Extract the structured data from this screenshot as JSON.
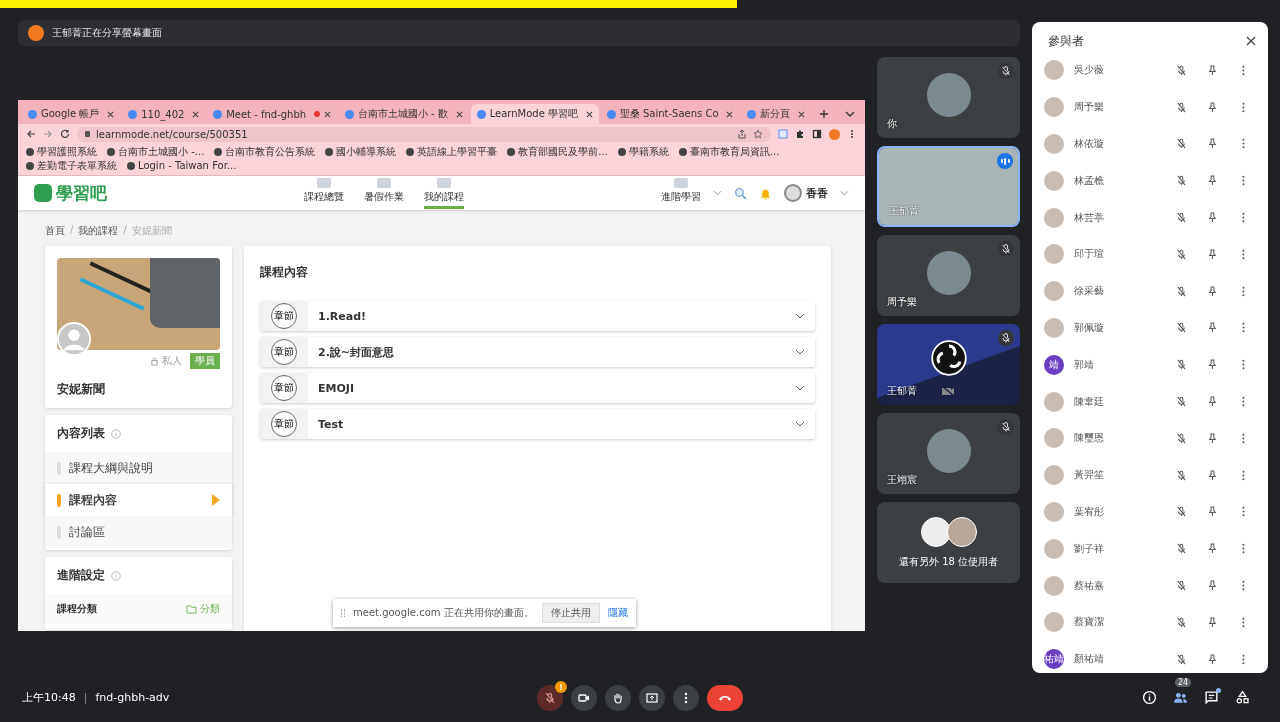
{
  "presentation_banner": {
    "text": "王郁菁正在分享螢幕畫面"
  },
  "shared_screen": {
    "browser": {
      "tabs": [
        {
          "title": "Google 帳戶",
          "selected": false,
          "recording": false
        },
        {
          "title": "110_402",
          "selected": false,
          "recording": false
        },
        {
          "title": "Meet - fnd-ghbh",
          "selected": false,
          "recording": true
        },
        {
          "title": "台南市土城國小 - 歡",
          "selected": false,
          "recording": false
        },
        {
          "title": "LearnMode 學習吧",
          "selected": true,
          "recording": false
        },
        {
          "title": "聖桑 Saint-Saens Co",
          "selected": false,
          "recording": false
        },
        {
          "title": "新分頁",
          "selected": false,
          "recording": false
        }
      ],
      "url": "learnmode.net/course/500351",
      "bookmarks": [
        {
          "label": "學習護照系統"
        },
        {
          "label": "台南市土城國小 -..."
        },
        {
          "label": "台南市教育公告系統"
        },
        {
          "label": "國小輔導系統"
        },
        {
          "label": "英語線上學習平臺"
        },
        {
          "label": "教育部國民及學前..."
        },
        {
          "label": "學籍系統"
        },
        {
          "label": "臺南市教育局資訊..."
        },
        {
          "label": "差勤電子表單系統"
        },
        {
          "label": "Login - Taiwan For..."
        }
      ]
    },
    "site": {
      "logo": "學習吧",
      "nav": [
        {
          "label": "課程總覽",
          "selected": false
        },
        {
          "label": "暑假作業",
          "selected": false
        },
        {
          "label": "我的課程",
          "selected": true
        }
      ],
      "advanced": "進階學習",
      "user": "香香",
      "breadcrumb": {
        "separator": "/",
        "items": [
          "首頁",
          "我的課程",
          "安妮新聞"
        ]
      },
      "course": {
        "privacy": "私人",
        "role": "學員",
        "title": "安妮新聞"
      },
      "content_list": {
        "title": "內容列表",
        "items": [
          {
            "label": "課程大綱與說明",
            "selected": false
          },
          {
            "label": "課程內容",
            "selected": true
          },
          {
            "label": "討論區",
            "selected": false
          }
        ]
      },
      "settings": {
        "title": "進階設定",
        "rows": [
          {
            "label": "課程分類",
            "action": "分類"
          }
        ]
      },
      "content": {
        "title": "課程內容",
        "chapters": [
          {
            "tag": "章節",
            "title": "1.Read!"
          },
          {
            "tag": "章節",
            "title": "2.說~封面意思"
          },
          {
            "tag": "章節",
            "title": "EMOJI"
          },
          {
            "tag": "章節",
            "title": "Test"
          }
        ]
      }
    },
    "share_notice": {
      "text": "meet.google.com 正在共用你的畫面。",
      "stop": "停止共用",
      "hide": "隱藏"
    }
  },
  "tiles": [
    {
      "name": "你",
      "kind": "avatar",
      "muted": true,
      "speaking": false
    },
    {
      "name": "王郁菁",
      "kind": "video",
      "muted": false,
      "speaking": true
    },
    {
      "name": "周予樂",
      "kind": "avatar",
      "muted": true,
      "speaking": false
    },
    {
      "name": "王郁菁",
      "kind": "logo",
      "muted": true,
      "speaking": false
    },
    {
      "name": "王翊宸",
      "kind": "avatar",
      "muted": true,
      "speaking": false
    }
  ],
  "more_tile": {
    "text": "還有另外 18 位使用者"
  },
  "participants_panel": {
    "title": "參與者",
    "participants": [
      {
        "name": "吳少薇",
        "kind": "photo",
        "muted": true
      },
      {
        "name": "周予樂",
        "kind": "photo",
        "muted": true
      },
      {
        "name": "林依璇",
        "kind": "photo",
        "muted": true
      },
      {
        "name": "林孟樵",
        "kind": "photo",
        "muted": true
      },
      {
        "name": "林芸葶",
        "kind": "photo",
        "muted": true
      },
      {
        "name": "邱于瑄",
        "kind": "photo",
        "muted": true
      },
      {
        "name": "徐采藝",
        "kind": "photo",
        "muted": true
      },
      {
        "name": "郭佩璇",
        "kind": "photo",
        "muted": true
      },
      {
        "name": "郭靖",
        "kind": "initials",
        "initials": "靖",
        "muted": true
      },
      {
        "name": "陳韋廷",
        "kind": "photo",
        "muted": true
      },
      {
        "name": "陳璽恩",
        "kind": "photo",
        "muted": true
      },
      {
        "name": "黃羿笙",
        "kind": "photo",
        "muted": true
      },
      {
        "name": "葉宥彤",
        "kind": "photo",
        "muted": true
      },
      {
        "name": "劉子祥",
        "kind": "photo",
        "muted": true
      },
      {
        "name": "蔡祐嘉",
        "kind": "photo",
        "muted": true
      },
      {
        "name": "蔡寶潔",
        "kind": "photo",
        "muted": true
      },
      {
        "name": "顏祐靖",
        "kind": "initials",
        "initials": "祐靖",
        "muted": true
      }
    ]
  },
  "bottom_bar": {
    "time": "上午10:48",
    "separator": "|",
    "meeting_code": "fnd-ghbh-adv",
    "mic_alert": "!",
    "people_count": "24",
    "chat_unread": true
  }
}
